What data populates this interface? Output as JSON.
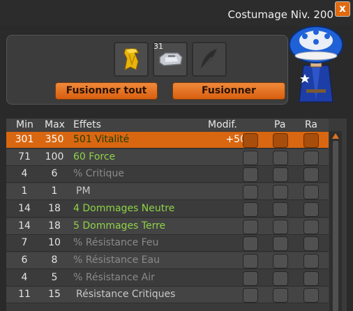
{
  "window": {
    "title": "Costumage Niv. 200",
    "close_label": "x"
  },
  "fusion": {
    "slots": [
      {
        "icon": "yellow-cloak-item-icon"
      },
      {
        "icon": "silver-gauntlet-item-icon",
        "count": "31"
      },
      {
        "icon": "feather-placeholder-icon"
      }
    ],
    "merge_all_label": "Fusionner tout",
    "merge_label": "Fusionner"
  },
  "table": {
    "headers": {
      "min": "Min",
      "max": "Max",
      "effects": "Effets",
      "modif": "Modif.",
      "pa": "Pa",
      "ra": "Ra"
    },
    "rows": [
      {
        "min": "301",
        "max": "350",
        "effect": "501 Vitalité",
        "modif": "+50",
        "style": "green",
        "selected": true
      },
      {
        "min": "71",
        "max": "100",
        "effect": "60 Force",
        "modif": "",
        "style": "green"
      },
      {
        "min": "4",
        "max": "6",
        "effect": "% Critique",
        "modif": "",
        "style": "grey"
      },
      {
        "min": "1",
        "max": "1",
        "effect": "PM",
        "modif": "",
        "style": "white"
      },
      {
        "min": "14",
        "max": "18",
        "effect": "4 Dommages Neutre",
        "modif": "",
        "style": "green"
      },
      {
        "min": "14",
        "max": "18",
        "effect": "5 Dommages Terre",
        "modif": "",
        "style": "green"
      },
      {
        "min": "7",
        "max": "10",
        "effect": "% Résistance Feu",
        "modif": "",
        "style": "grey"
      },
      {
        "min": "6",
        "max": "8",
        "effect": "% Résistance Eau",
        "modif": "",
        "style": "grey"
      },
      {
        "min": "4",
        "max": "5",
        "effect": "% Résistance Air",
        "modif": "",
        "style": "grey"
      },
      {
        "min": "11",
        "max": "15",
        "effect": "Résistance Critiques",
        "modif": "",
        "style": "white"
      }
    ]
  },
  "colors": {
    "accent": "#d96711",
    "green_text": "#8fd248",
    "grey_text": "#8a8a8a"
  }
}
